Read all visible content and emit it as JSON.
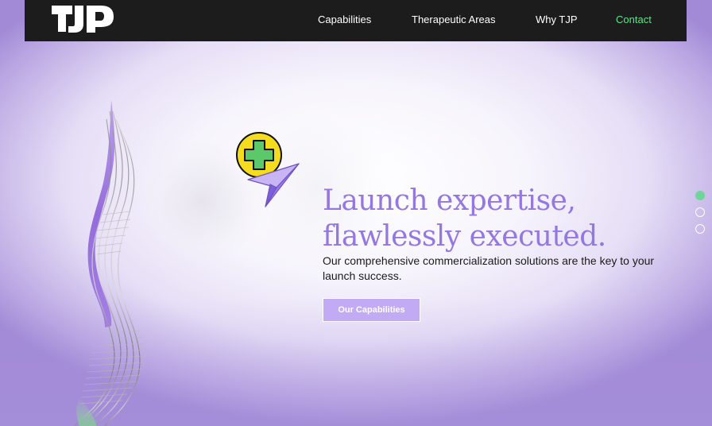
{
  "nav": {
    "logo_text": "TJP",
    "links": [
      {
        "label": "Capabilities"
      },
      {
        "label": "Therapeutic Areas"
      },
      {
        "label": "Why TJP"
      },
      {
        "label": "Contact"
      }
    ]
  },
  "hero": {
    "headline_line1": "Launch expertise,",
    "headline_line2": "flawlessly executed.",
    "subtext": "Our comprehensive commercialization solutions are the key to your launch success.",
    "cta_label": "Our Capabilities"
  },
  "slider": {
    "count": 3,
    "active_index": 0
  },
  "colors": {
    "nav_background": "#1c1c1c",
    "accent_purple": "#9477e0",
    "cta_background": "#c2aaf5",
    "contact_green": "#5ee38a",
    "active_dot_green": "#6fd69a",
    "icon_yellow": "#f5dc1e"
  },
  "icons": [
    "medical-cross-icon",
    "paper-plane-icon"
  ]
}
